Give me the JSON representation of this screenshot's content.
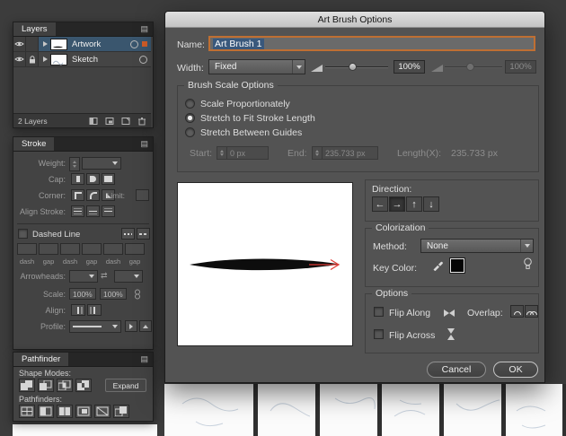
{
  "icons": {
    "panel_menu": "▤",
    "swap_arrows": "⇄",
    "direction_arrows": [
      "←",
      "→",
      "↑",
      "↓"
    ]
  },
  "layers_panel": {
    "tab_label": "Layers",
    "rows": [
      {
        "name": "Artwork",
        "selected": true
      },
      {
        "name": "Sketch",
        "selected": false
      }
    ],
    "status": "2 Layers"
  },
  "stroke_panel": {
    "tab_label": "Stroke",
    "labels": {
      "weight": "Weight:",
      "cap": "Cap:",
      "corner": "Corner:",
      "limit": "Limit:",
      "align_stroke": "Align Stroke:",
      "dashed_line": "Dashed Line",
      "arrowheads": "Arrowheads:",
      "scale": "Scale:",
      "align": "Align:",
      "profile": "Profile:"
    },
    "dash_labels": [
      "dash",
      "gap",
      "dash",
      "gap",
      "dash",
      "gap"
    ],
    "scale_values": [
      "100%",
      "100%"
    ]
  },
  "pathfinder_panel": {
    "tab_label": "Pathfinder",
    "shape_modes_label": "Shape Modes:",
    "expand_label": "Expand",
    "pathfinders_label": "Pathfinders:"
  },
  "dialog": {
    "title": "Art Brush Options",
    "name_label": "Name:",
    "name_value": "Art Brush 1",
    "width_label": "Width:",
    "width_type": "Fixed",
    "width_value": "100%",
    "width_value_secondary": "100%",
    "brush_scale": {
      "legend": "Brush Scale Options",
      "options": [
        {
          "label": "Scale Proportionately",
          "selected": false
        },
        {
          "label": "Stretch to Fit Stroke Length",
          "selected": true
        },
        {
          "label": "Stretch Between Guides",
          "selected": false
        }
      ],
      "start_label": "Start:",
      "start_value": "0 px",
      "end_label": "End:",
      "end_value": "235.733 px",
      "length_label": "Length(X):",
      "length_value": "235.733 px"
    },
    "direction_label": "Direction:",
    "colorization": {
      "legend": "Colorization",
      "method_label": "Method:",
      "method_value": "None",
      "key_color_label": "Key Color:"
    },
    "options": {
      "legend": "Options",
      "flip_along_label": "Flip Along",
      "flip_across_label": "Flip Across",
      "overlap_label": "Overlap:"
    },
    "cancel_label": "Cancel",
    "ok_label": "OK"
  }
}
